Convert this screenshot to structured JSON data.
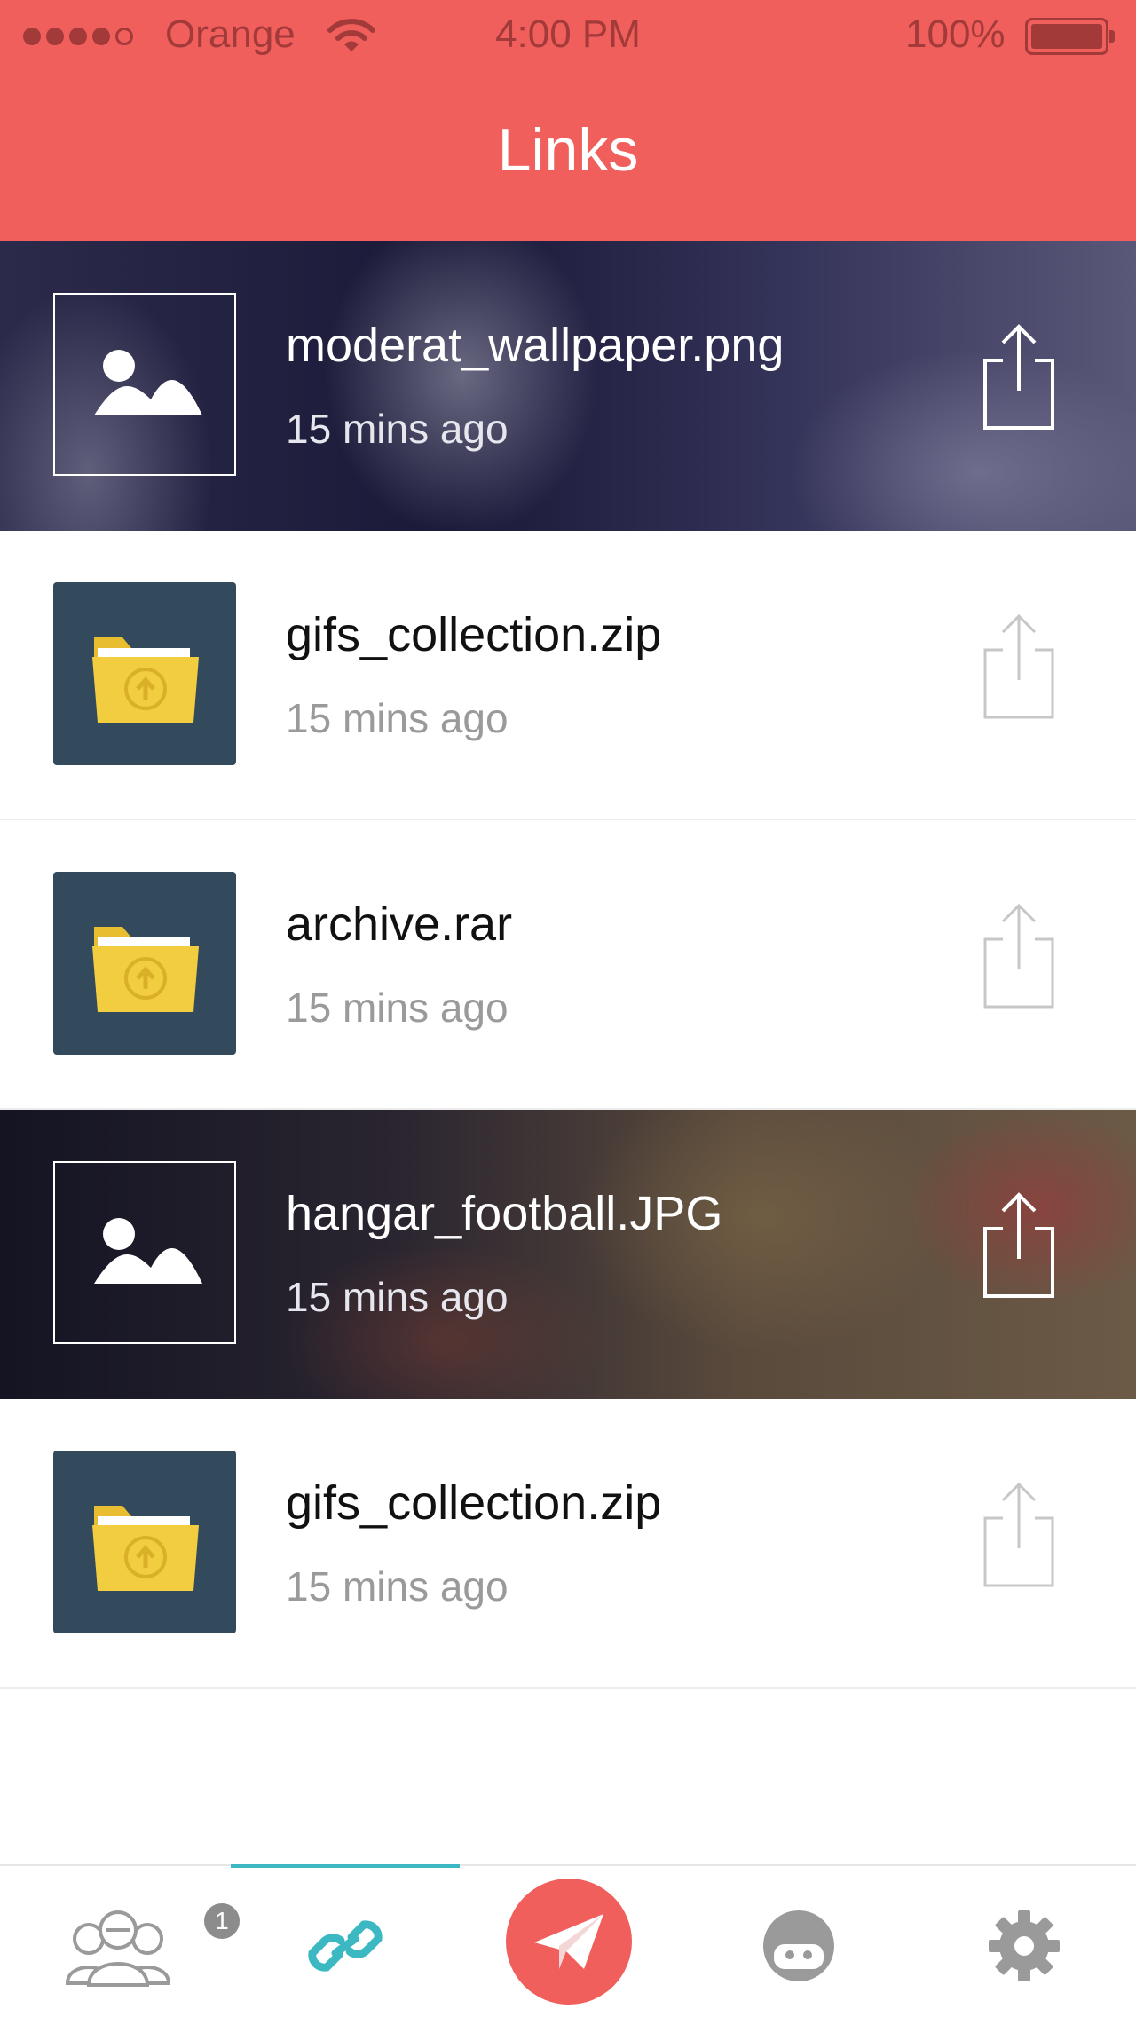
{
  "status_bar": {
    "carrier": "Orange",
    "time": "4:00 PM",
    "battery": "100%"
  },
  "header": {
    "title": "Links"
  },
  "links": [
    {
      "name": "moderat_wallpaper.png",
      "time": "15 mins ago",
      "kind": "image"
    },
    {
      "name": "gifs_collection.zip",
      "time": "15 mins ago",
      "kind": "folder"
    },
    {
      "name": "archive.rar",
      "time": "15 mins ago",
      "kind": "folder"
    },
    {
      "name": "hangar_football.JPG",
      "time": "15 mins ago",
      "kind": "image"
    },
    {
      "name": "gifs_collection.zip",
      "time": "15 mins ago",
      "kind": "folder"
    }
  ],
  "tabbar": {
    "friends_badge": "1",
    "active_tab": "links",
    "icons": [
      "friends-icon",
      "link-icon",
      "paper-plane-icon",
      "avatar-icon",
      "gear-icon"
    ]
  },
  "colors": {
    "header": "#f05f5c",
    "accent_teal": "#3cb8c2",
    "folder_tile": "#334a5c",
    "folder_yellow": "#f2cd3f"
  }
}
